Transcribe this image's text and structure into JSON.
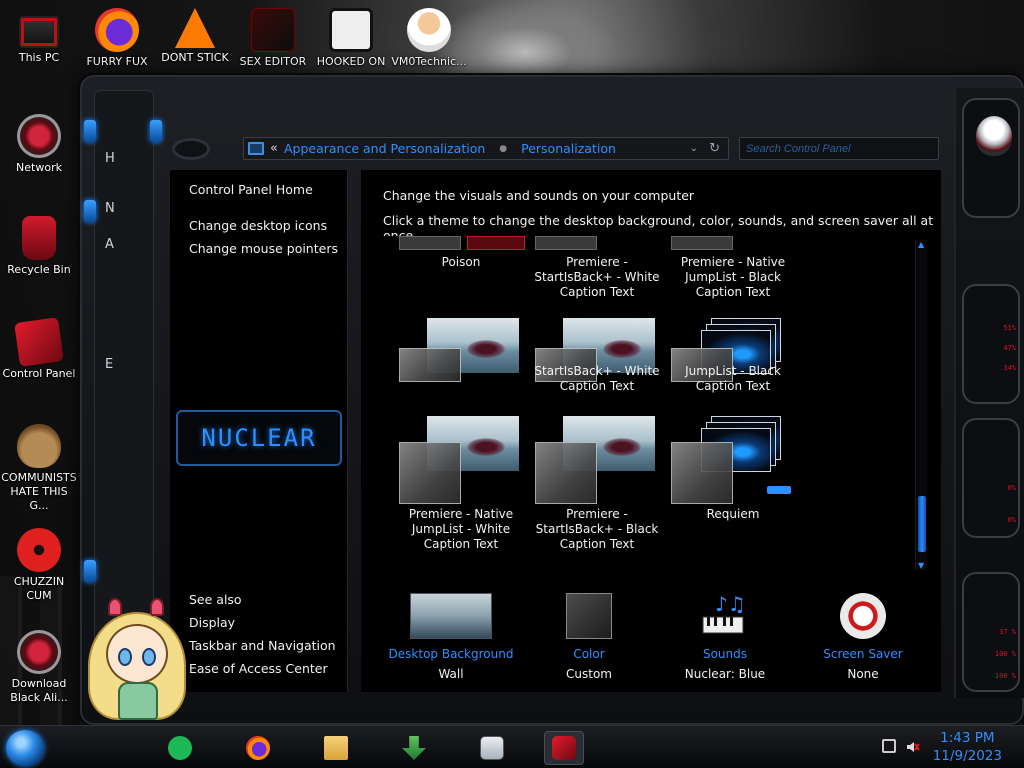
{
  "desktop": {
    "icons": [
      {
        "label": "This PC",
        "icon": "computer-icon"
      },
      {
        "label": "FURRY FUX",
        "icon": "firefox-icon"
      },
      {
        "label": "DONT STICK",
        "icon": "vlc-icon"
      },
      {
        "label": "SEX EDITOR",
        "icon": "app-icon"
      },
      {
        "label": "HOOKED ON",
        "icon": "app-icon"
      },
      {
        "label": "VM0Technic...",
        "icon": "user-icon"
      },
      {
        "label": "Network",
        "icon": "network-icon"
      },
      {
        "label": "Recycle Bin",
        "icon": "recycle-bin-icon"
      },
      {
        "label": "Control Panel",
        "icon": "control-panel-icon"
      },
      {
        "label": "COMMUNISTS HATE THIS G...",
        "icon": "money-bag-icon"
      },
      {
        "label": "CHUZZIN CUM",
        "icon": "chuzzle-icon"
      },
      {
        "label": "Download Black Ali...",
        "icon": "alien-icon"
      }
    ]
  },
  "window": {
    "breadcrumb": {
      "back_chevrons": "«",
      "items": [
        "Appearance and Personalization",
        "Personalization"
      ]
    },
    "search_placeholder": "Search Control Panel",
    "side_letters": [
      "H",
      "N",
      "A",
      "E"
    ]
  },
  "left_pane": {
    "home": "Control Panel Home",
    "links": [
      "Change desktop icons",
      "Change mouse pointers"
    ],
    "logo_text": "NUCLEAR",
    "see_also_heading": "See also",
    "see_also": [
      "Display",
      "Taskbar and Navigation",
      "Ease of Access Center"
    ]
  },
  "content": {
    "heading": "Change the visuals and sounds on your computer",
    "subheading": "Click a theme to change the desktop background, color, sounds, and screen saver all at once.",
    "themes_row1": [
      {
        "name": "Poison"
      },
      {
        "name": "Premiere - StartIsBack+ - White Caption Text"
      },
      {
        "name": "Premiere - Native JumpList - Black Caption Text"
      }
    ],
    "themes_row2": [
      {
        "name": "StartIsBack+ - White Caption Text"
      },
      {
        "name": "JumpList - Black Caption Text"
      }
    ],
    "themes_row3": [
      {
        "name": "Premiere - Native JumpList - White Caption Text"
      },
      {
        "name": "Premiere - StartIsBack+ - Black Caption Text"
      },
      {
        "name": "Requiem"
      }
    ]
  },
  "settings": [
    {
      "label": "Desktop Background",
      "value": "Wall",
      "icon": "desktop-background-icon"
    },
    {
      "label": "Color",
      "value": "Custom",
      "icon": "color-swatch-icon"
    },
    {
      "label": "Sounds",
      "value": "Nuclear: Blue",
      "icon": "sounds-icon"
    },
    {
      "label": "Screen Saver",
      "value": "None",
      "icon": "screen-saver-icon"
    }
  ],
  "hud": {
    "stats": [
      "51%",
      "47%",
      "34%",
      "0%",
      "0%",
      "37 %",
      "100 %",
      "100 %"
    ]
  },
  "taskbar": {
    "time": "1:43 PM",
    "date": "11/9/2023",
    "apps": [
      "spotify-icon",
      "firefox-icon",
      "file-explorer-icon",
      "download-icon",
      "monitor-icon",
      "control-panel-icon"
    ]
  },
  "colors": {
    "accent": "#2f8fff",
    "alert": "#d3122a",
    "background": "#000000"
  }
}
